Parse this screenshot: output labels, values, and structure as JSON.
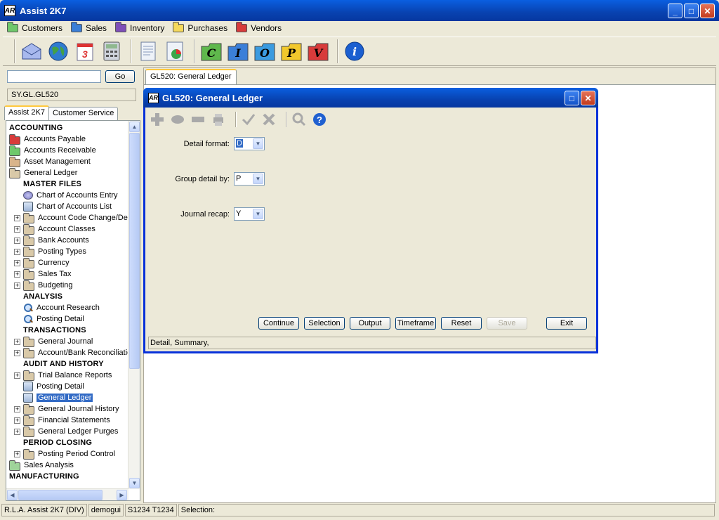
{
  "app": {
    "title": "Assist 2K7",
    "logo": "AR"
  },
  "menubar": [
    {
      "label": "Customers",
      "color": "#6fc86b"
    },
    {
      "label": "Sales",
      "color": "#3b7fd8"
    },
    {
      "label": "Inventory",
      "color": "#7e4fb8"
    },
    {
      "label": "Purchases",
      "color": "#f5d95c"
    },
    {
      "label": "Vendors",
      "color": "#d83b3b"
    }
  ],
  "toolbar": {
    "tools": [
      "mail-icon",
      "globe-icon",
      "calendar-icon",
      "calculator-icon",
      "report-icon",
      "chart-icon"
    ],
    "letters": [
      {
        "label": "C",
        "color": "#5fb84c"
      },
      {
        "label": "I",
        "color": "#3b7fd8"
      },
      {
        "label": "O",
        "color": "#3b9be0"
      },
      {
        "label": "P",
        "color": "#f2c82c"
      },
      {
        "label": "V",
        "color": "#d83b3b"
      }
    ],
    "info_label": "i"
  },
  "left": {
    "go_label": "Go",
    "search_value": "",
    "path": "SY.GL.GL520",
    "tabs": [
      "Assist 2K7",
      "Customer Service"
    ]
  },
  "tree": [
    {
      "label": "ACCOUNTING",
      "kind": "header",
      "indent": 0
    },
    {
      "label": "Accounts Payable",
      "kind": "folder",
      "color": "#d83b3b",
      "indent": 0
    },
    {
      "label": "Accounts Receivable",
      "kind": "folder",
      "color": "#6fc86b",
      "indent": 0
    },
    {
      "label": "Asset Management",
      "kind": "folder",
      "color": "#d9b48a",
      "indent": 0
    },
    {
      "label": "General Ledger",
      "kind": "folder",
      "color": "#d9c9a8",
      "indent": 0
    },
    {
      "label": "MASTER FILES",
      "kind": "header",
      "indent": 1
    },
    {
      "label": "Chart of Accounts Entry",
      "kind": "pen",
      "indent": 1
    },
    {
      "label": "Chart of Accounts List",
      "kind": "doc",
      "indent": 1
    },
    {
      "label": "Account Code Change/Dele",
      "kind": "folder",
      "color": "#d9c9a8",
      "indent": 1,
      "exp": true
    },
    {
      "label": "Account Classes",
      "kind": "folder",
      "color": "#d9c9a8",
      "indent": 1,
      "exp": true
    },
    {
      "label": "Bank Accounts",
      "kind": "folder",
      "color": "#d9c9a8",
      "indent": 1,
      "exp": true
    },
    {
      "label": "Posting Types",
      "kind": "folder",
      "color": "#d9c9a8",
      "indent": 1,
      "exp": true
    },
    {
      "label": "Currency",
      "kind": "folder",
      "color": "#d9c9a8",
      "indent": 1,
      "exp": true
    },
    {
      "label": "Sales Tax",
      "kind": "folder",
      "color": "#d9c9a8",
      "indent": 1,
      "exp": true
    },
    {
      "label": "Budgeting",
      "kind": "folder",
      "color": "#d9c9a8",
      "indent": 1,
      "exp": true
    },
    {
      "label": "ANALYSIS",
      "kind": "header",
      "indent": 1
    },
    {
      "label": "Account Research",
      "kind": "mag",
      "indent": 1
    },
    {
      "label": "Posting Detail",
      "kind": "mag",
      "indent": 1
    },
    {
      "label": "TRANSACTIONS",
      "kind": "header",
      "indent": 1
    },
    {
      "label": "General Journal",
      "kind": "folder",
      "color": "#d9c9a8",
      "indent": 1,
      "exp": true
    },
    {
      "label": "Account/Bank Reconciliatio",
      "kind": "folder",
      "color": "#d9c9a8",
      "indent": 1,
      "exp": true
    },
    {
      "label": "AUDIT AND HISTORY",
      "kind": "header",
      "indent": 1
    },
    {
      "label": "Trial Balance Reports",
      "kind": "folder",
      "color": "#d9c9a8",
      "indent": 1,
      "exp": true
    },
    {
      "label": "Posting Detail",
      "kind": "doc",
      "indent": 1
    },
    {
      "label": "General Ledger",
      "kind": "doc",
      "indent": 1,
      "selected": true
    },
    {
      "label": "General Journal History",
      "kind": "folder",
      "color": "#d9c9a8",
      "indent": 1,
      "exp": true
    },
    {
      "label": "Financial Statements",
      "kind": "folder",
      "color": "#d9c9a8",
      "indent": 1,
      "exp": true
    },
    {
      "label": "General Ledger Purges",
      "kind": "folder",
      "color": "#d9c9a8",
      "indent": 1,
      "exp": true
    },
    {
      "label": "PERIOD CLOSING",
      "kind": "header",
      "indent": 1
    },
    {
      "label": "Posting Period Control",
      "kind": "folder",
      "color": "#d9c9a8",
      "indent": 1,
      "exp": true
    },
    {
      "label": "Sales Analysis",
      "kind": "folder",
      "color": "#9fd39a",
      "indent": 0
    },
    {
      "label": "MANUFACTURING",
      "kind": "header",
      "indent": 0
    }
  ],
  "main": {
    "tab_label": "GL520: General Ledger"
  },
  "dialog": {
    "title": "GL520: General Ledger",
    "fields": [
      {
        "label": "Detail format:",
        "value": "D",
        "highlighted": true
      },
      {
        "label": "Group detail by:",
        "value": "P",
        "highlighted": false
      },
      {
        "label": "Journal recap:",
        "value": "Y",
        "highlighted": false
      }
    ],
    "buttons": [
      {
        "label": "Continue",
        "enabled": true
      },
      {
        "label": "Selection",
        "enabled": true
      },
      {
        "label": "Output",
        "enabled": true
      },
      {
        "label": "Timeframe",
        "enabled": true
      },
      {
        "label": "Reset",
        "enabled": true
      },
      {
        "label": "Save",
        "enabled": false
      },
      {
        "label": "Exit",
        "enabled": true
      }
    ],
    "status": "Detail,  Summary,"
  },
  "statusbar": [
    "R.L.A. Assist 2K7 (DIV)",
    "demogui",
    "S1234 T1234",
    "Selection:"
  ]
}
